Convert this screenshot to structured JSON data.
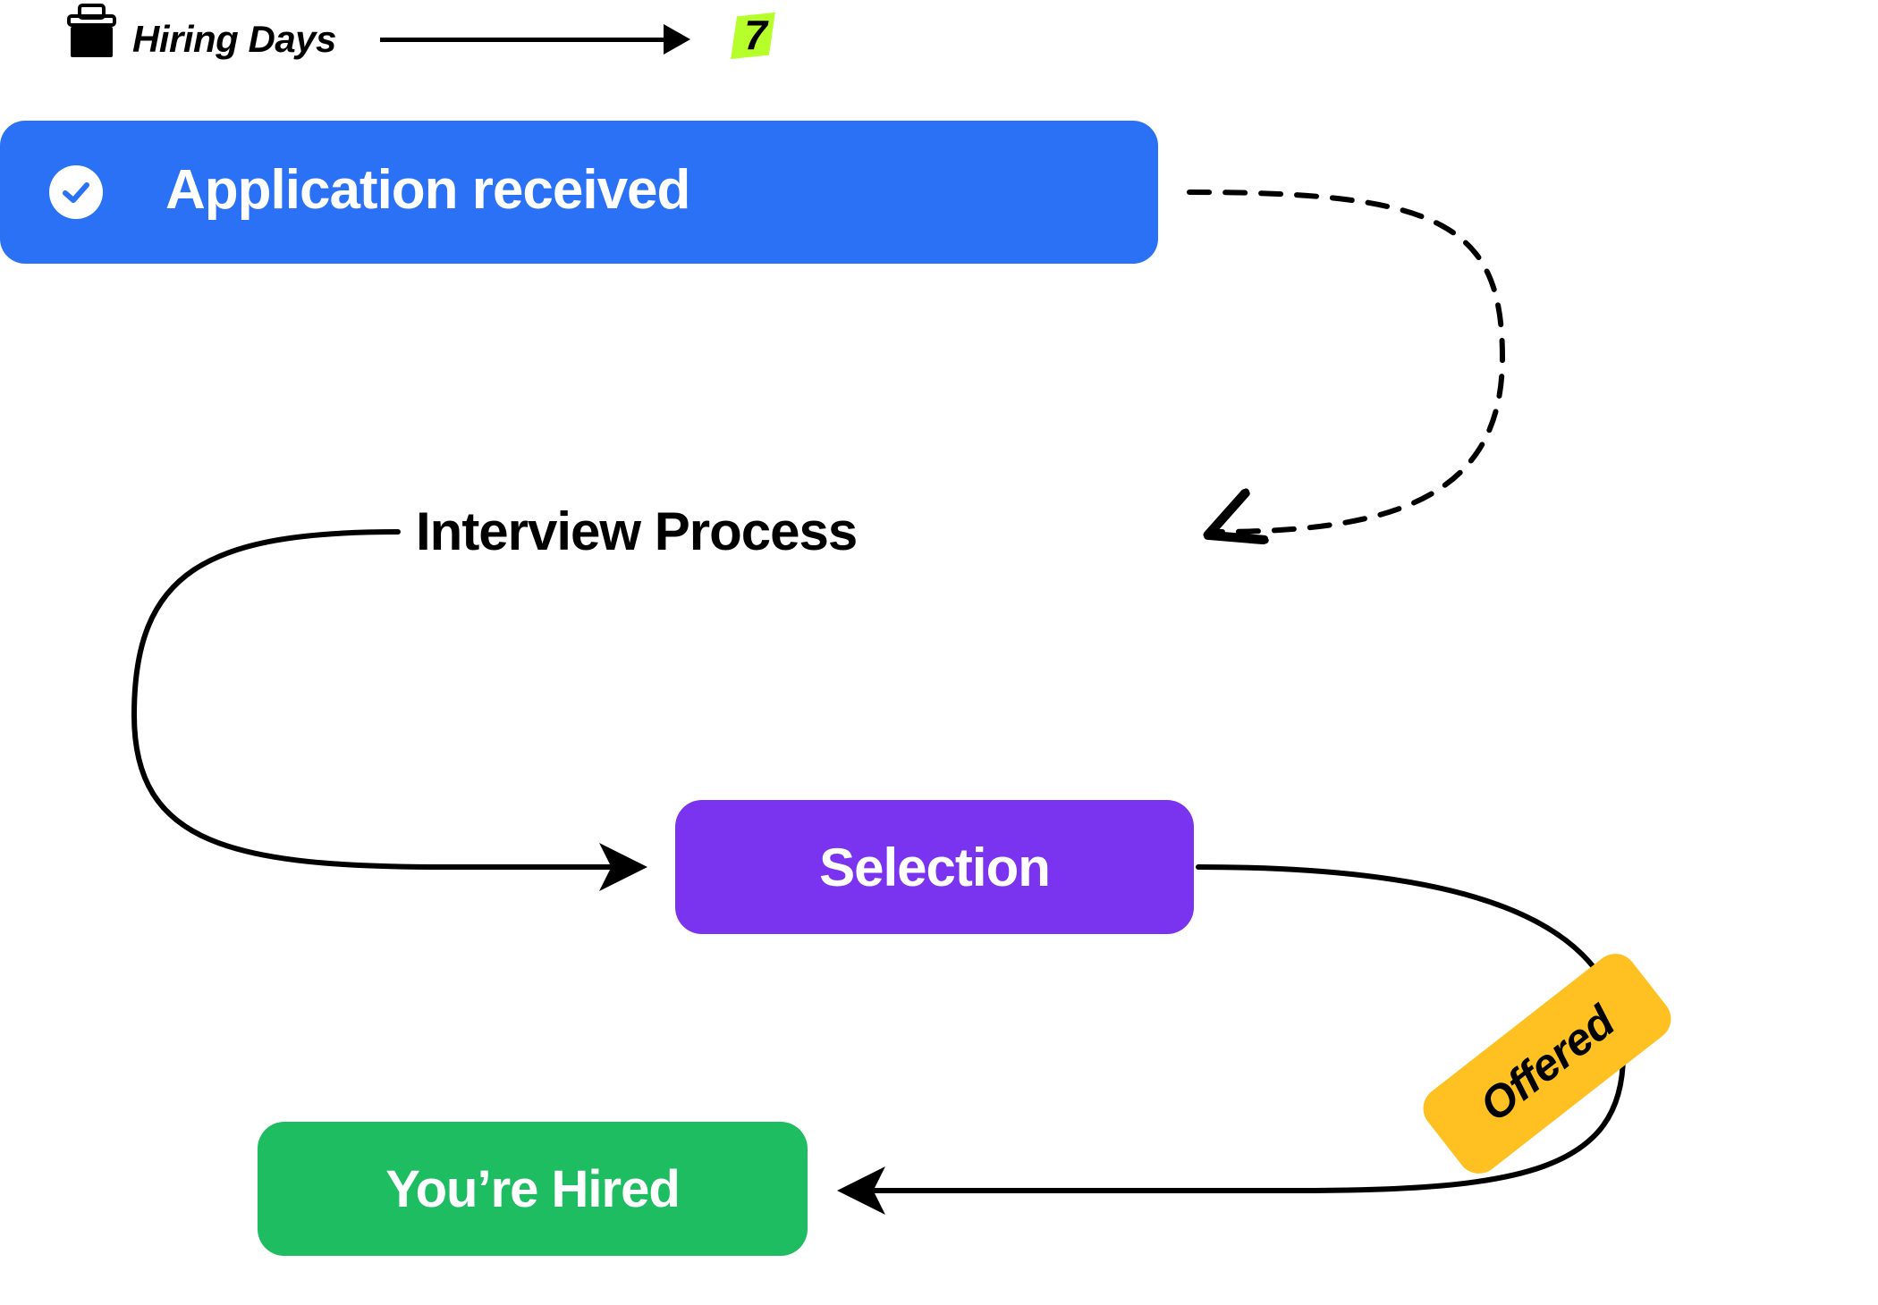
{
  "header": {
    "label": "Hiring Days",
    "days_value": "7"
  },
  "steps": {
    "application_received": "Application received",
    "interview_process": "Interview Process",
    "selection": "Selection",
    "offered": "Offered",
    "hired": "You’re Hired"
  },
  "colors": {
    "blue": "#2a71f6",
    "purple": "#7a34f0",
    "green": "#1fbd62",
    "yellow": "#ffc122",
    "lime": "#b7ff2b"
  },
  "chart_data": {
    "type": "diagram",
    "title": "Hiring Days",
    "duration_days": 7,
    "nodes": [
      {
        "id": "application_received",
        "label": "Application received",
        "status": "done"
      },
      {
        "id": "interview_process",
        "label": "Interview Process"
      },
      {
        "id": "selection",
        "label": "Selection"
      },
      {
        "id": "offered",
        "label": "Offered"
      },
      {
        "id": "hired",
        "label": "You’re Hired"
      }
    ],
    "edges": [
      {
        "from": "application_received",
        "to": "interview_process",
        "style": "dashed"
      },
      {
        "from": "interview_process",
        "to": "selection",
        "style": "solid"
      },
      {
        "from": "selection",
        "to": "offered",
        "style": "solid"
      },
      {
        "from": "offered",
        "to": "hired",
        "style": "solid"
      }
    ]
  }
}
